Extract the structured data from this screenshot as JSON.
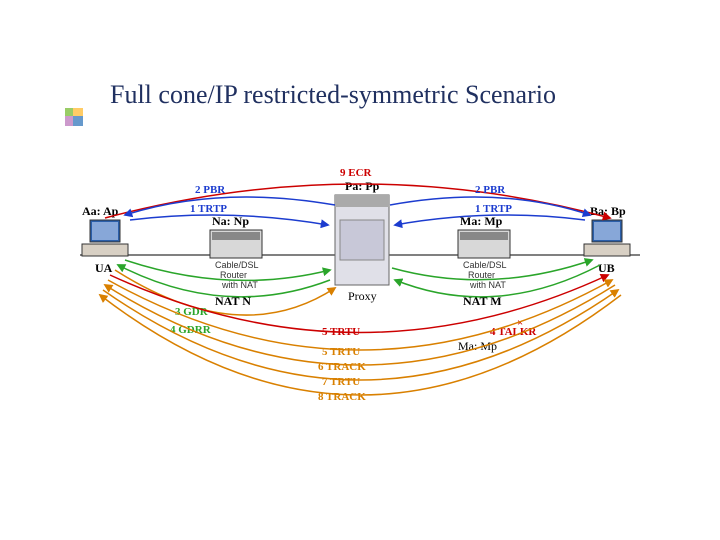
{
  "title": "Full cone/IP restricted-symmetric Scenario",
  "nodes": {
    "ua": {
      "addr": "Aa: Ap",
      "name": "UA"
    },
    "natN": {
      "addr": "Na: Np",
      "desc1": "Cable/DSL",
      "desc2": "Router",
      "desc3": "with NAT",
      "name": "NAT N"
    },
    "proxy": {
      "addr": "Pa: Pp",
      "name": "Proxy"
    },
    "natM": {
      "addr": "Ma: Mp",
      "desc1": "Cable/DSL",
      "desc2": "Router",
      "desc3": "with NAT",
      "name": "NAT M"
    },
    "ub": {
      "addr": "Ba: Bp",
      "name": "UB"
    }
  },
  "steps": {
    "s1": "1 TRTP",
    "s1b": "1 TRTP",
    "s2": "2 PBR",
    "s2b": "2 PBR",
    "s3": "3 GDR",
    "s4": "4 GDRR",
    "s4talkr": "4 TALKR",
    "mamp": "Ma: Mp",
    "s5": "5 TRTU",
    "s5b": "5 TRTU",
    "s6": "6 TRACK",
    "s7": "7 TRTU",
    "s8": "8 TRACK",
    "s9": "9 ECR"
  },
  "chart_data": {
    "type": "diagram",
    "title": "Full cone/IP restricted-symmetric Scenario",
    "nodes": [
      {
        "id": "UA",
        "label": "UA",
        "addr": "Aa:Ap",
        "kind": "host"
      },
      {
        "id": "NATN",
        "label": "NAT N",
        "addr": "Na:Np",
        "kind": "nat",
        "note": "Cable/DSL Router with NAT"
      },
      {
        "id": "Proxy",
        "label": "Proxy",
        "addr": "Pa:Pp",
        "kind": "server"
      },
      {
        "id": "NATM",
        "label": "NAT M",
        "addr": "Ma:Mp",
        "kind": "nat",
        "note": "Cable/DSL Router with NAT"
      },
      {
        "id": "UB",
        "label": "UB",
        "addr": "Ba:Bp",
        "kind": "host"
      }
    ],
    "edges": [
      {
        "step": 1,
        "label": "TRTP",
        "from": "UA",
        "to": "Proxy",
        "color": "blue"
      },
      {
        "step": 1,
        "label": "TRTP",
        "from": "UB",
        "to": "Proxy",
        "color": "blue"
      },
      {
        "step": 2,
        "label": "PBR",
        "from": "Proxy",
        "to": "UA",
        "color": "blue"
      },
      {
        "step": 2,
        "label": "PBR",
        "from": "Proxy",
        "to": "UB",
        "color": "blue"
      },
      {
        "step": 3,
        "label": "GDR",
        "from": "UA",
        "to": "Proxy",
        "color": "green"
      },
      {
        "step": 4,
        "label": "GDRR",
        "from": "Proxy",
        "to": "UA",
        "color": "green"
      },
      {
        "step": 4,
        "label": "TALKR",
        "from": "UA",
        "to": "UB",
        "color": "red",
        "blocked": true,
        "via": "Ma:Mp"
      },
      {
        "step": 5,
        "label": "TRTU",
        "from": "UA",
        "to": "Proxy",
        "color": "orange"
      },
      {
        "step": 5,
        "label": "TRTU",
        "from": "UA",
        "to": "UB",
        "color": "orange"
      },
      {
        "step": 6,
        "label": "TRACK",
        "from": "UB",
        "to": "UA",
        "color": "orange"
      },
      {
        "step": 7,
        "label": "TRTU",
        "from": "UA",
        "to": "UB",
        "color": "orange"
      },
      {
        "step": 8,
        "label": "TRACK",
        "from": "UB",
        "to": "UA",
        "color": "orange"
      },
      {
        "step": 9,
        "label": "ECR",
        "from": "UA",
        "to": "UB",
        "color": "red"
      }
    ]
  }
}
